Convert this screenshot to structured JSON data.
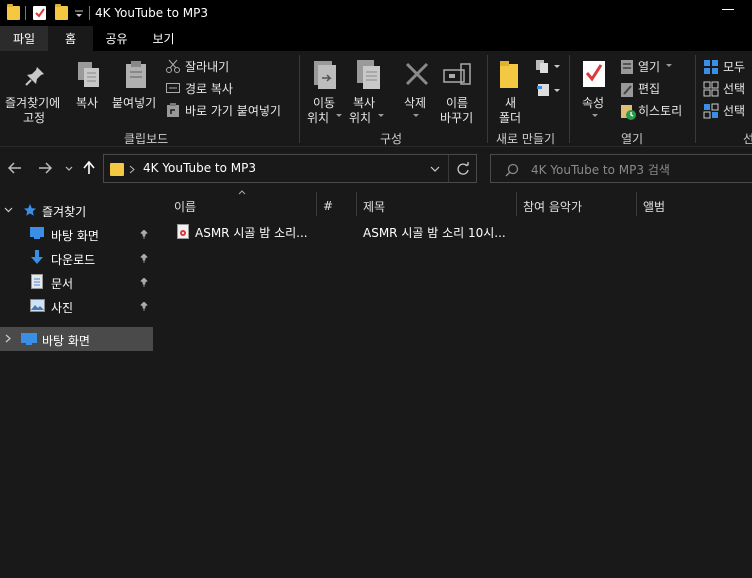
{
  "titlebar": {
    "title": "4K YouTube to MP3"
  },
  "tabs": {
    "file": "파일",
    "home": "홈",
    "share": "공유",
    "view": "보기"
  },
  "ribbon": {
    "clipboard": {
      "pin": "즐겨찾기에",
      "pin2": "고정",
      "copy": "복사",
      "paste": "붙여넣기",
      "cut": "잘라내기",
      "copy_path": "경로 복사",
      "paste_shortcut": "바로 가기 붙여넣기",
      "group": "클립보드"
    },
    "organize": {
      "move1": "이동",
      "move2": "위치",
      "copyto1": "복사",
      "copyto2": "위치",
      "delete": "삭제",
      "rename1": "이름",
      "rename2": "바꾸기",
      "group": "구성"
    },
    "new": {
      "folder1": "새",
      "folder2": "폴더",
      "group": "새로 만들기"
    },
    "open": {
      "properties": "속성",
      "open": "열기",
      "edit": "편집",
      "history": "히스토리",
      "group": "열기"
    },
    "select": {
      "all": "모두",
      "none": "선택",
      "invert": "선택",
      "group": "선"
    }
  },
  "address": {
    "path": "4K YouTube to MP3",
    "search_placeholder": "4K YouTube to MP3 검색"
  },
  "navpane": {
    "quick_access": "즐겨찾기",
    "items": [
      {
        "label": "바탕 화면",
        "icon": "desktop-icon"
      },
      {
        "label": "다운로드",
        "icon": "download-icon"
      },
      {
        "label": "문서",
        "icon": "document-icon"
      },
      {
        "label": "사진",
        "icon": "pictures-icon"
      }
    ],
    "desktop_root": "바탕 화면"
  },
  "columns": [
    "이름",
    "#",
    "제목",
    "참여 음악가",
    "앨범"
  ],
  "files": [
    {
      "name": "ASMR 시골 밤 소리...",
      "number": "",
      "title": "ASMR 시골 밤 소리 10시...",
      "artist": "",
      "album": ""
    }
  ],
  "colors": {
    "background": "#191919",
    "chrome": "#000000",
    "accent_blue": "#3a8ee6",
    "folder_yellow": "#f5c842",
    "selection": "#4a4a4a"
  }
}
